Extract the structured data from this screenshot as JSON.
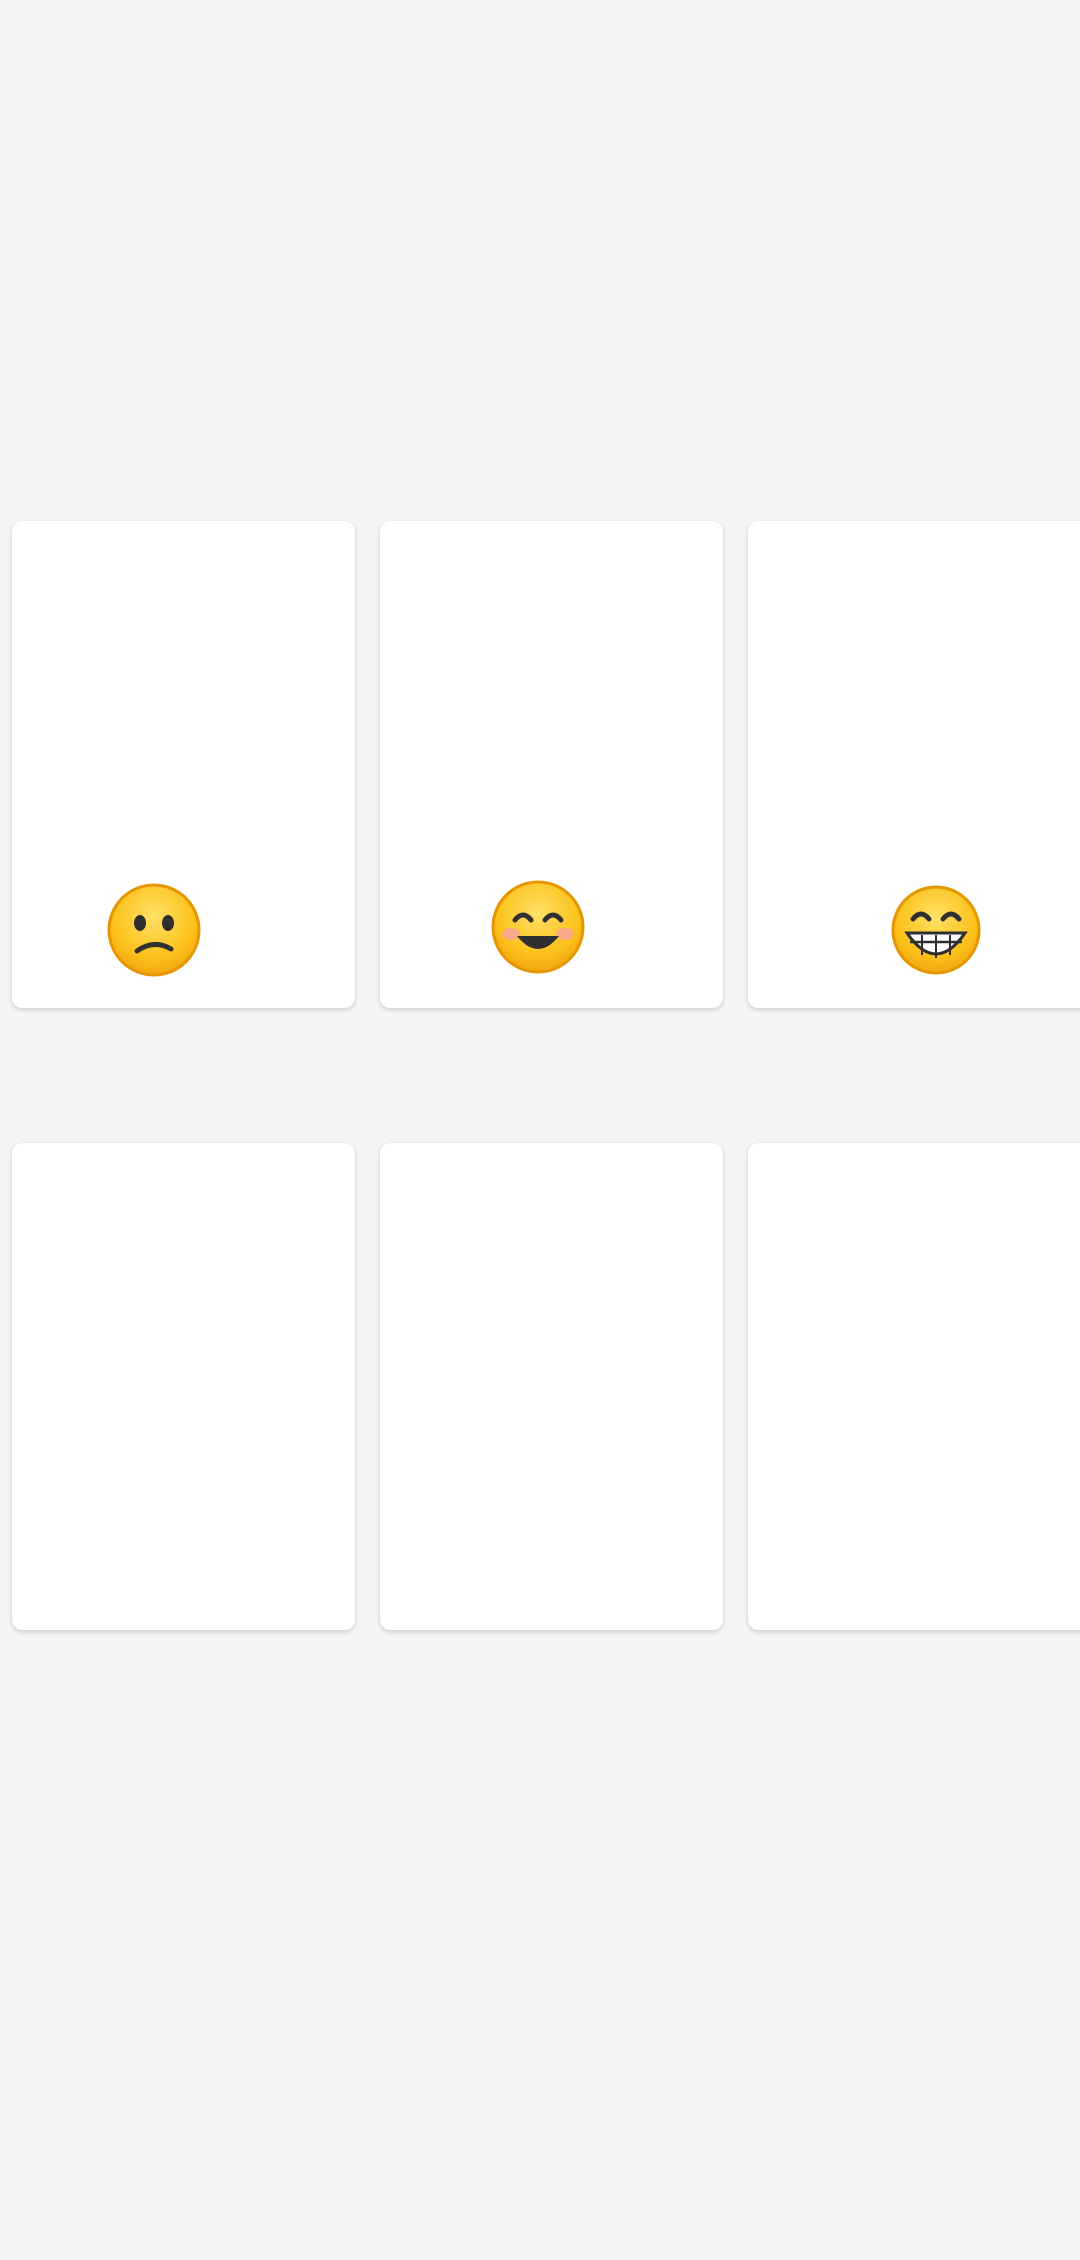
{
  "screen": {
    "background": "#f5f5f6"
  },
  "cards": [
    {
      "icon": "confused-face-icon",
      "emoji": "🙁"
    },
    {
      "icon": "smiling-face-with-smiling-eyes-icon",
      "emoji": "😊"
    },
    {
      "icon": "beaming-face-with-grinning-teeth-icon",
      "emoji": "😁"
    },
    {
      "icon": "",
      "emoji": ""
    },
    {
      "icon": "",
      "emoji": ""
    },
    {
      "icon": "",
      "emoji": ""
    }
  ],
  "colors": {
    "card": "#ffffff",
    "emoji_face": "#fcc21b",
    "emoji_outline": "#e59600",
    "emoji_features": "#2f2f2f",
    "blush": "#f4a3a3"
  }
}
